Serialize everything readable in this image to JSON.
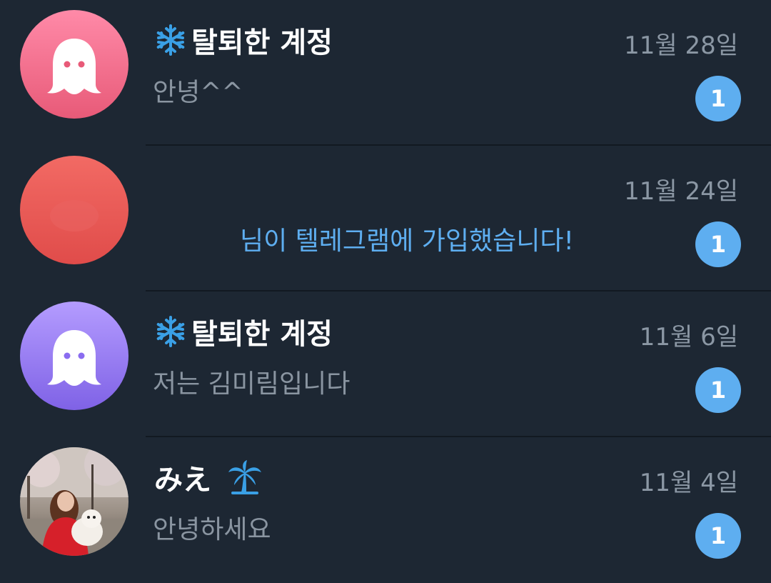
{
  "chats": [
    {
      "avatar_icon": "ghost-icon",
      "avatar_color": "#f06d8c",
      "status_emoji": "snowflake-icon",
      "name": "탈퇴한 계정",
      "date": "11월 28일",
      "preview": "안녕^^",
      "unread": "1"
    },
    {
      "avatar_color": "#e85a55",
      "date": "11월 24일",
      "preview": "님이 텔레그램에 가입했습니다!",
      "unread": "1"
    },
    {
      "avatar_icon": "ghost-icon",
      "avatar_color": "#9a80f5",
      "status_emoji": "snowflake-icon",
      "name": "탈퇴한 계정",
      "date": "11월 6일",
      "preview": "저는 김미림입니다",
      "unread": "1"
    },
    {
      "avatar_icon": "profile-photo",
      "status_emoji": "palm-tree-icon",
      "name": "みえ",
      "date": "11월 4일",
      "preview": "안녕하세요",
      "unread": "1"
    }
  ],
  "colors": {
    "background": "#1d2733",
    "badge": "#5eaef0",
    "service_text": "#5eaef0",
    "secondary_text": "#8b97a4"
  }
}
